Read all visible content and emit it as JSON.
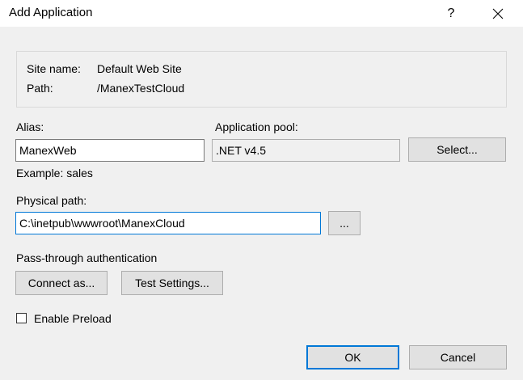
{
  "window": {
    "title": "Add Application",
    "help_label": "?"
  },
  "site_info": {
    "site_name_label": "Site name:",
    "site_name_value": "Default Web Site",
    "path_label": "Path:",
    "path_value": "/ManexTestCloud"
  },
  "alias": {
    "label": "Alias:",
    "value": "ManexWeb",
    "example": "Example: sales"
  },
  "app_pool": {
    "label": "Application pool:",
    "value": ".NET v4.5",
    "select_label": "Select..."
  },
  "physical_path": {
    "label": "Physical path:",
    "value": "C:\\inetpub\\wwwroot\\ManexCloud",
    "browse_label": "..."
  },
  "auth": {
    "label": "Pass-through authentication",
    "connect_label": "Connect as...",
    "test_label": "Test Settings..."
  },
  "preload": {
    "label": "Enable Preload",
    "checked": false
  },
  "footer": {
    "ok_label": "OK",
    "cancel_label": "Cancel"
  },
  "colors": {
    "background": "#f0f0f0",
    "accent": "#0078d7",
    "button_face": "#e1e1e1"
  }
}
